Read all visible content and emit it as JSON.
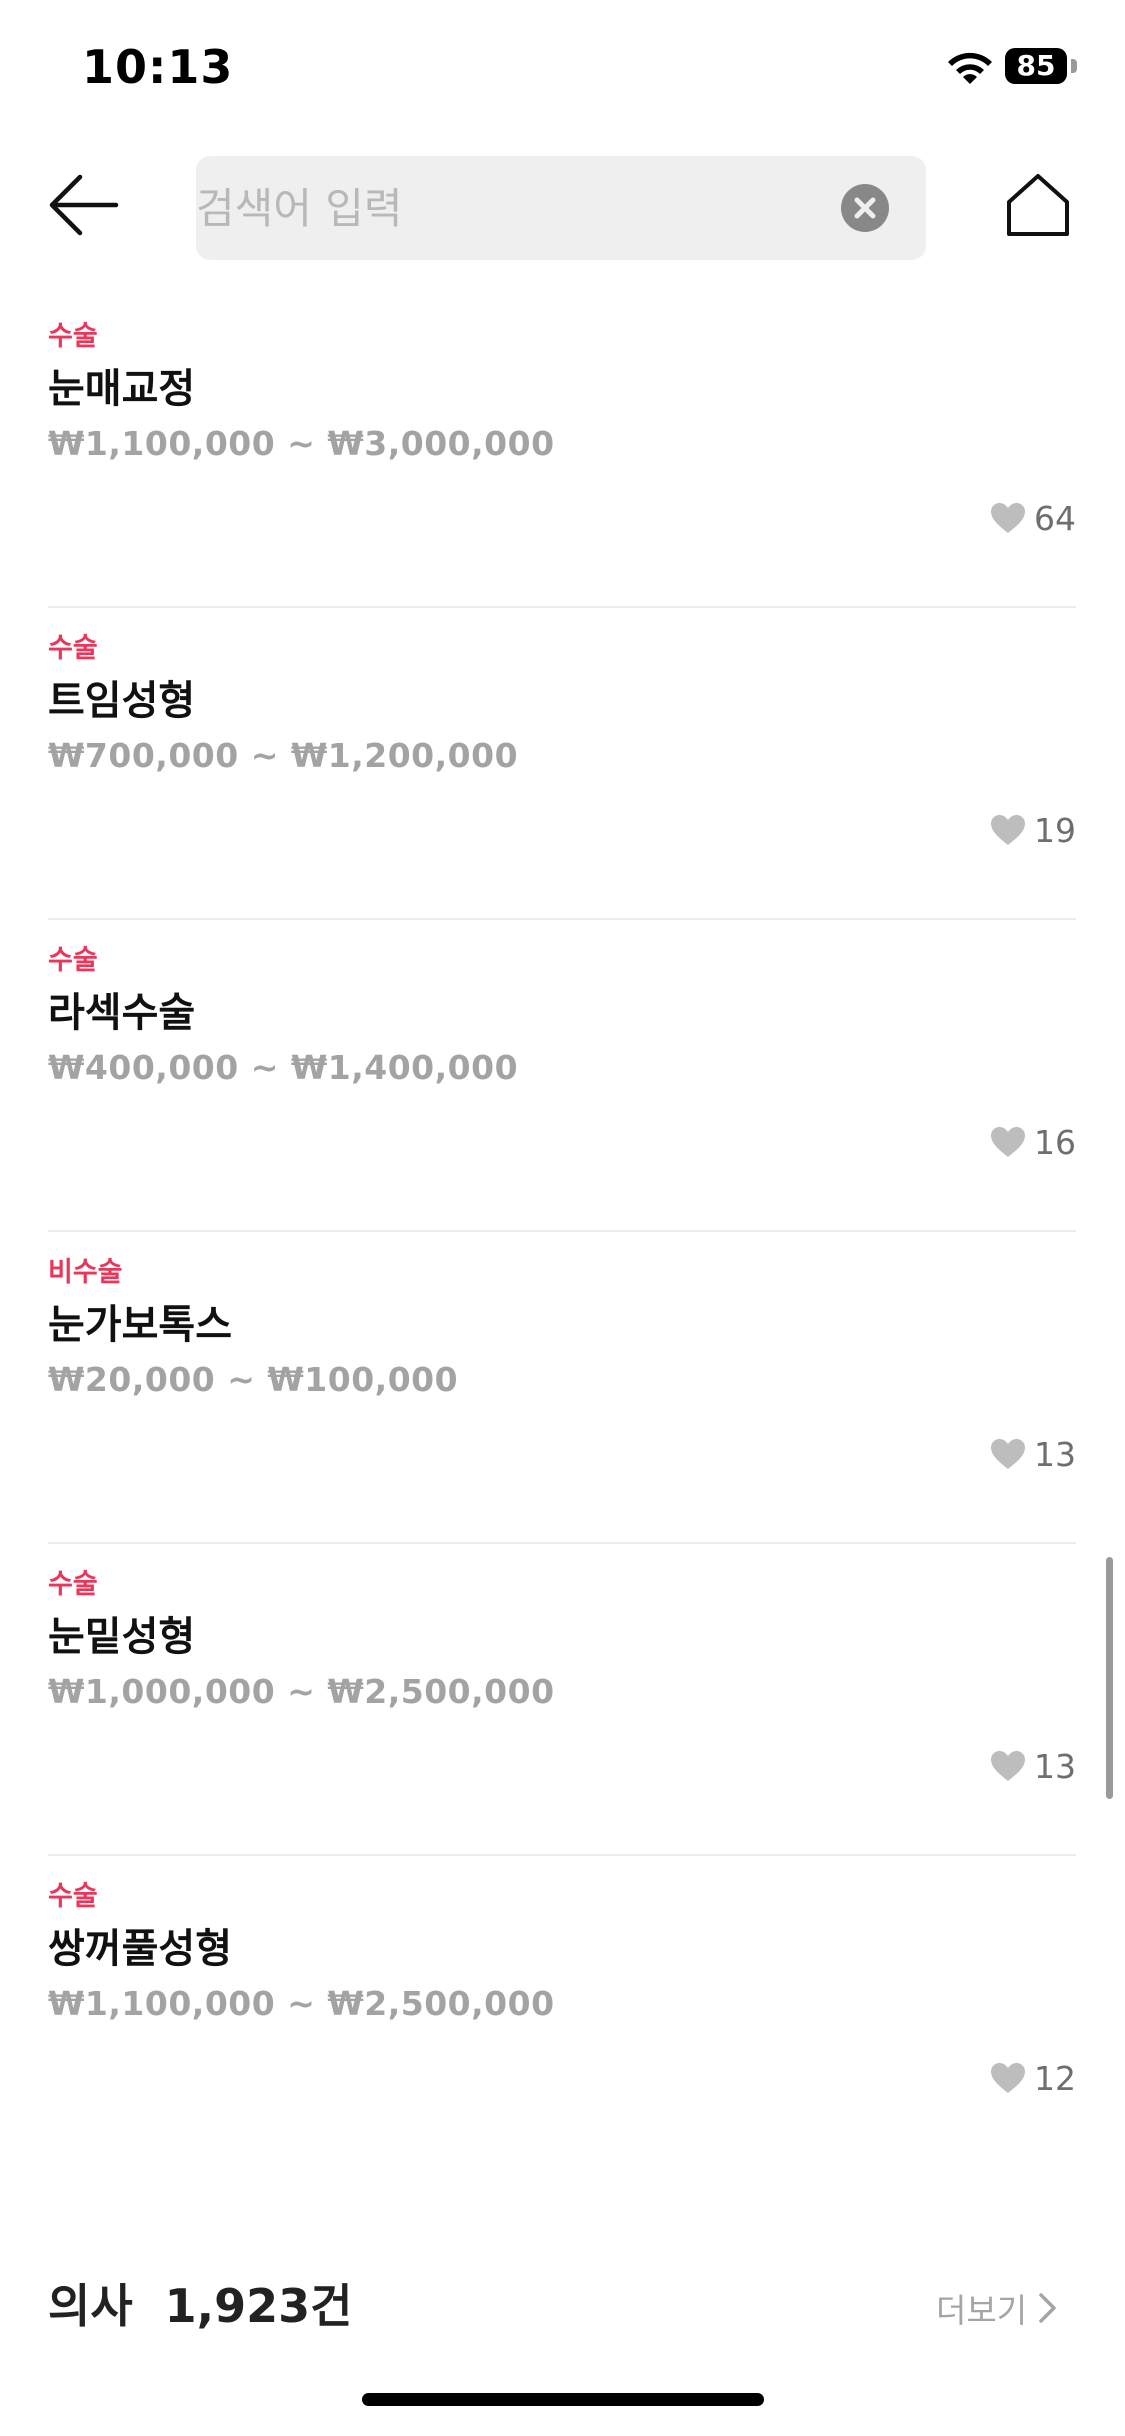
{
  "status_bar": {
    "time": "10:13",
    "battery": "85"
  },
  "search": {
    "placeholder": "검색어 입력",
    "value": ""
  },
  "items": [
    {
      "category": "수술",
      "name": "눈매교정",
      "price": "₩1,100,000 ~ ₩3,000,000",
      "likes": "64"
    },
    {
      "category": "수술",
      "name": "트임성형",
      "price": "₩700,000 ~ ₩1,200,000",
      "likes": "19"
    },
    {
      "category": "수술",
      "name": "라섹수술",
      "price": "₩400,000 ~ ₩1,400,000",
      "likes": "16"
    },
    {
      "category": "비수술",
      "name": "눈가보톡스",
      "price": "₩20,000 ~ ₩100,000",
      "likes": "13"
    },
    {
      "category": "수술",
      "name": "눈밑성형",
      "price": "₩1,000,000 ~ ₩2,500,000",
      "likes": "13"
    },
    {
      "category": "수술",
      "name": "쌍꺼풀성형",
      "price": "₩1,100,000 ~ ₩2,500,000",
      "likes": "12"
    }
  ],
  "doctors": {
    "title": "의사  1,923건",
    "more_label": "더보기"
  },
  "colors": {
    "category": "#e8375a",
    "price": "#a3a3a3",
    "heart": "#bdbdbd",
    "search_bg": "#efefef"
  },
  "icons": {
    "back": "arrow-left-icon",
    "clear": "clear-circle-icon",
    "home": "home-icon",
    "like": "heart-icon",
    "more": "chevron-right-icon"
  }
}
